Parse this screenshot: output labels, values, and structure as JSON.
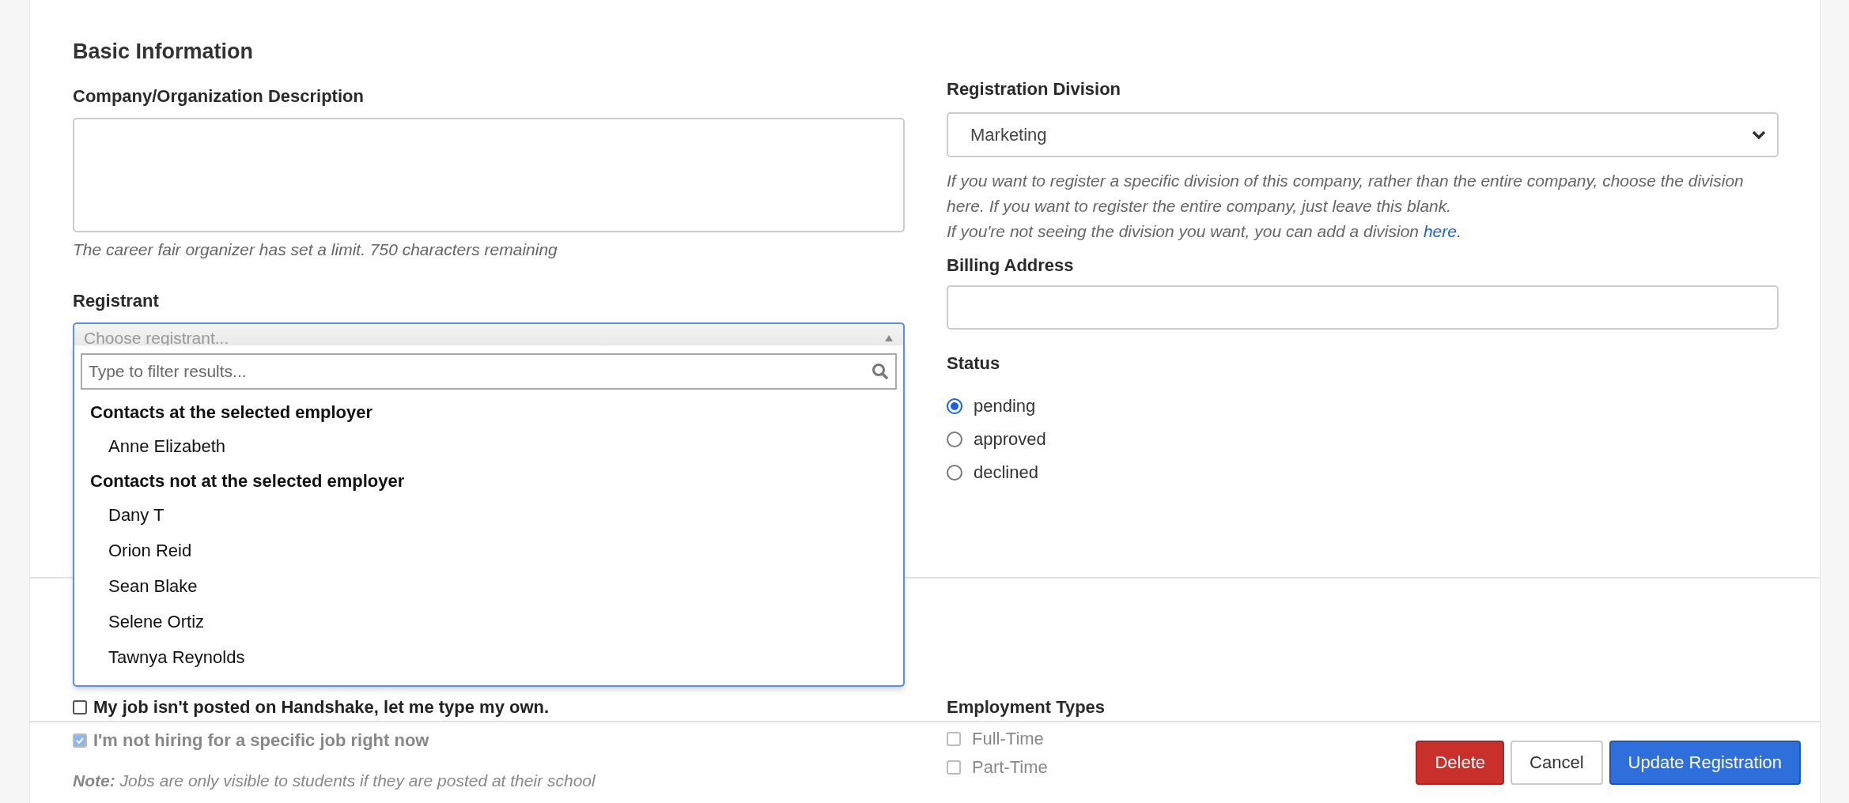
{
  "section_title": "Basic Information",
  "description": {
    "label": "Company/Organization Description",
    "hint": "The career fair organizer has set a limit. 750 characters remaining"
  },
  "registrant": {
    "label": "Registrant",
    "placeholder": "Choose registrant...",
    "expanded": true,
    "filter_placeholder": "Type to filter results...",
    "groups": [
      {
        "label": "Contacts at the selected employer",
        "items": [
          "Anne Elizabeth"
        ]
      },
      {
        "label": "Contacts not at the selected employer",
        "items": [
          "Dany T",
          "Orion Reid",
          "Sean Blake",
          "Selene Ortiz",
          "Tawnya Reynolds"
        ]
      }
    ]
  },
  "division": {
    "label": "Registration Division",
    "value": "Marketing",
    "help": "If you want to register a specific division of this company, rather than the entire company, choose the division here. If you want to register the entire company, just leave this blank.",
    "help_2": "If you're not seeing the division you want, you can add a division ",
    "link": "here."
  },
  "billing": {
    "label": "Billing Address"
  },
  "status": {
    "label": "Status",
    "options": [
      {
        "label": "pending",
        "selected": true
      },
      {
        "label": "approved",
        "selected": false
      },
      {
        "label": "declined",
        "selected": false
      }
    ]
  },
  "job_options": [
    {
      "label": "My job isn't posted on Handshake, let me type my own.",
      "checked": false,
      "disabled": false
    },
    {
      "label": "I'm not hiring for a specific job right now",
      "checked": true,
      "disabled": true
    }
  ],
  "note": "**Note:** Jobs are only visible to students if they are posted at their school",
  "employment_types": {
    "label": "Employment Types",
    "options": [
      {
        "label": "Full-Time",
        "checked": false
      },
      {
        "label": "Part-Time",
        "checked": false
      }
    ]
  },
  "buttons": [
    {
      "label": "Delete",
      "kind": "danger"
    },
    {
      "label": "Cancel",
      "kind": "secondary"
    },
    {
      "label": "Update Registration",
      "kind": "primary"
    }
  ]
}
